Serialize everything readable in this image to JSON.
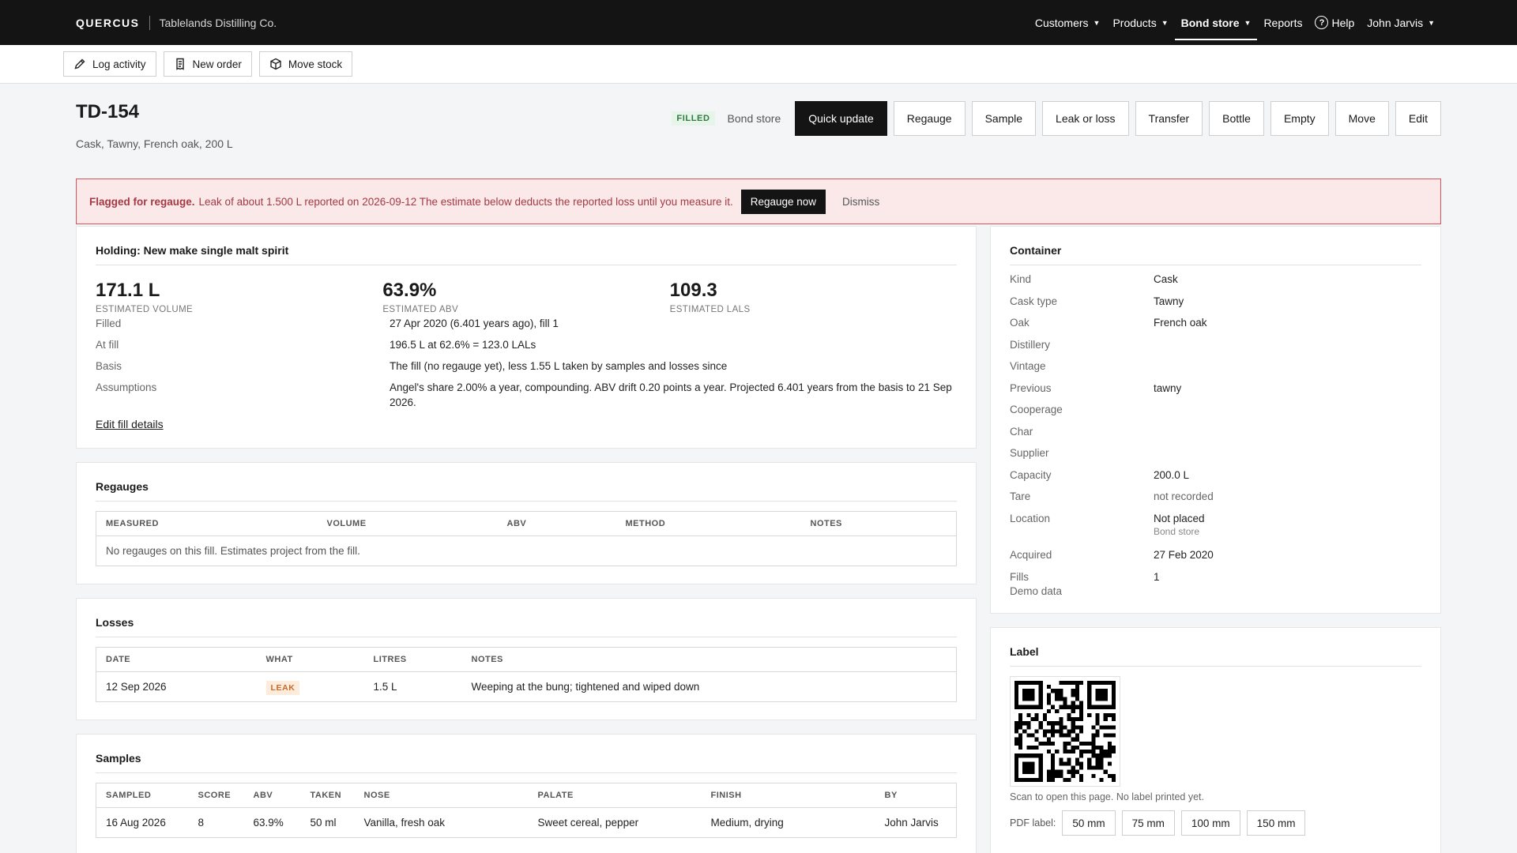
{
  "topbar": {
    "brand": "QUERCUS",
    "org": "Tablelands Distilling Co.",
    "nav": [
      {
        "label": "Customers",
        "dropdown": true
      },
      {
        "label": "Products",
        "dropdown": true
      },
      {
        "label": "Bond store",
        "dropdown": true,
        "active": true
      },
      {
        "label": "Reports",
        "dropdown": false
      }
    ],
    "help": "Help",
    "user": "John Jarvis"
  },
  "actionbar": {
    "log_activity": "Log activity",
    "new_order": "New order",
    "move_stock": "Move stock"
  },
  "header": {
    "title": "TD-154",
    "subtitle": "Cask, Tawny, French oak, 200 L",
    "status_badge": "FILLED",
    "location": "Bond store",
    "buttons": {
      "quick_update": "Quick update",
      "regauge": "Regauge",
      "sample": "Sample",
      "leak": "Leak or loss",
      "transfer": "Transfer",
      "bottle": "Bottle",
      "empty": "Empty",
      "move": "Move",
      "edit": "Edit"
    }
  },
  "alert": {
    "title": "Flagged for regauge.",
    "message": "Leak of about 1.500 L reported on 2026-09-12 The estimate below deducts the reported loss until you measure it.",
    "action": "Regauge now",
    "dismiss": "Dismiss"
  },
  "holding": {
    "title": "Holding: New make single malt spirit",
    "volume": "171.1 L",
    "volume_label": "ESTIMATED VOLUME",
    "abv": "63.9%",
    "abv_label": "ESTIMATED ABV",
    "lals": "109.3",
    "lals_label": "ESTIMATED LALS",
    "rows": [
      {
        "k": "Filled",
        "v": "27 Apr 2020 (6.401 years ago), fill 1"
      },
      {
        "k": "At fill",
        "v": "196.5 L at 62.6% = 123.0 LALs"
      },
      {
        "k": "Basis",
        "v": "The fill (no regauge yet), less 1.55 L taken by samples and losses since"
      },
      {
        "k": "Assumptions",
        "v": "Angel's share 2.00% a year, compounding. ABV drift 0.20 points a year. Projected 6.401 years from the basis to 21 Sep 2026."
      }
    ],
    "edit_link": "Edit fill details"
  },
  "regauges": {
    "title": "Regauges",
    "columns": [
      "MEASURED",
      "VOLUME",
      "ABV",
      "METHOD",
      "NOTES"
    ],
    "empty": "No regauges on this fill. Estimates project from the fill."
  },
  "losses": {
    "title": "Losses",
    "columns": [
      "DATE",
      "WHAT",
      "LITRES",
      "NOTES"
    ],
    "rows": [
      {
        "date": "12 Sep 2026",
        "what": "LEAK",
        "litres": "1.5 L",
        "notes": "Weeping at the bung; tightened and wiped down"
      }
    ]
  },
  "samples": {
    "title": "Samples",
    "columns": [
      "SAMPLED",
      "SCORE",
      "ABV",
      "TAKEN",
      "NOSE",
      "PALATE",
      "FINISH",
      "BY"
    ],
    "rows": [
      {
        "sampled": "16 Aug 2026",
        "score": "8",
        "abv": "63.9%",
        "taken": "50 ml",
        "nose": "Vanilla, fresh oak",
        "palate": "Sweet cereal, pepper",
        "finish": "Medium, drying",
        "by": "John Jarvis"
      }
    ]
  },
  "container": {
    "title": "Container",
    "rows": [
      {
        "k": "Kind",
        "v": "Cask"
      },
      {
        "k": "Cask type",
        "v": "Tawny"
      },
      {
        "k": "Oak",
        "v": "French oak"
      },
      {
        "k": "Distillery",
        "v": ""
      },
      {
        "k": "Vintage",
        "v": ""
      },
      {
        "k": "Previous",
        "v": "tawny"
      },
      {
        "k": "Cooperage",
        "v": ""
      },
      {
        "k": "Char",
        "v": ""
      },
      {
        "k": "Supplier",
        "v": ""
      },
      {
        "k": "Capacity",
        "v": "200.0 L"
      },
      {
        "k": "Tare",
        "v": "not recorded"
      },
      {
        "k": "Location",
        "v": "Not placed"
      }
    ],
    "location_sub": "Bond store",
    "rows2": [
      {
        "k": "Acquired",
        "v": "27 Feb 2020"
      },
      {
        "k": "Fills",
        "v": "1"
      }
    ],
    "footer": "Demo data"
  },
  "label": {
    "title": "Label",
    "caption": "Scan to open this page. No label printed yet.",
    "pdf_label": "PDF label:",
    "sizes": [
      "50 mm",
      "75 mm",
      "100 mm",
      "150 mm"
    ]
  }
}
